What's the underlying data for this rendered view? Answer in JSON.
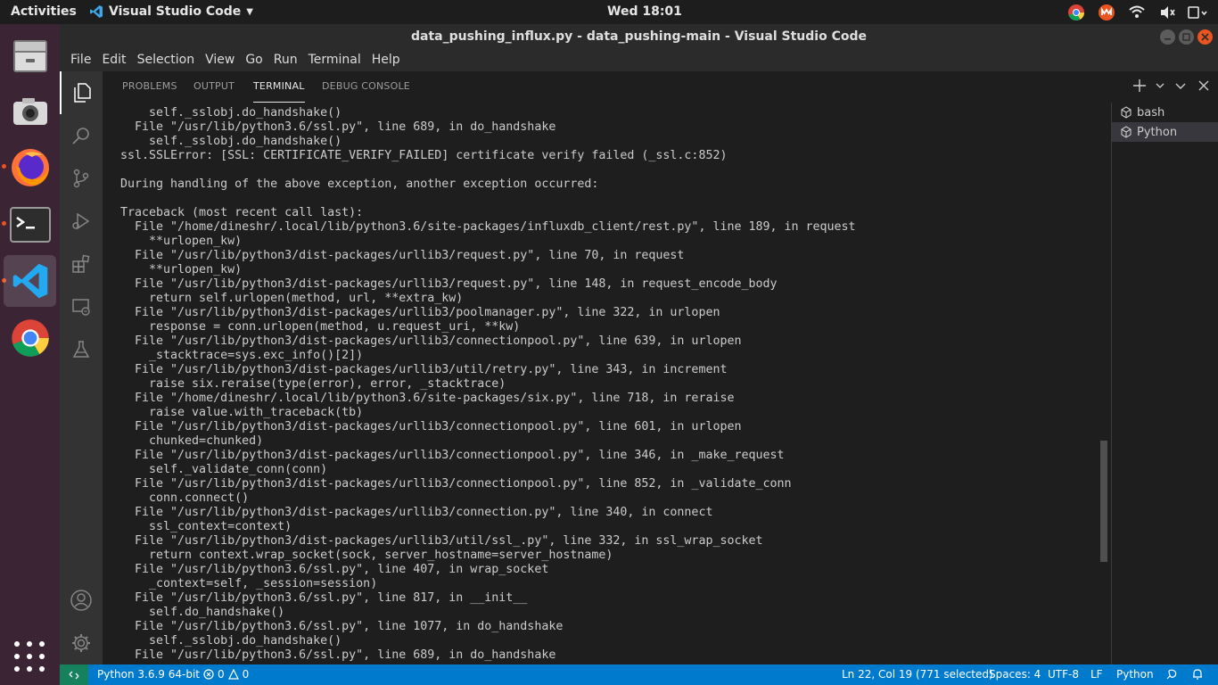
{
  "topbar": {
    "activities": "Activities",
    "app_name": "Visual Studio Code",
    "clock": "Wed 18:01"
  },
  "window": {
    "title": "data_pushing_influx.py - data_pushing-main - Visual Studio Code"
  },
  "menu": [
    "File",
    "Edit",
    "Selection",
    "View",
    "Go",
    "Run",
    "Terminal",
    "Help"
  ],
  "panel": {
    "tabs": [
      "PROBLEMS",
      "OUTPUT",
      "TERMINAL",
      "DEBUG CONSOLE"
    ],
    "active_tab": "TERMINAL"
  },
  "terminal_lines": [
    "    self._sslobj.do_handshake()",
    "  File \"/usr/lib/python3.6/ssl.py\", line 689, in do_handshake",
    "    self._sslobj.do_handshake()",
    "ssl.SSLError: [SSL: CERTIFICATE_VERIFY_FAILED] certificate verify failed (_ssl.c:852)",
    "",
    "During handling of the above exception, another exception occurred:",
    "",
    "Traceback (most recent call last):",
    "  File \"/home/dineshr/.local/lib/python3.6/site-packages/influxdb_client/rest.py\", line 189, in request",
    "    **urlopen_kw)",
    "  File \"/usr/lib/python3/dist-packages/urllib3/request.py\", line 70, in request",
    "    **urlopen_kw)",
    "  File \"/usr/lib/python3/dist-packages/urllib3/request.py\", line 148, in request_encode_body",
    "    return self.urlopen(method, url, **extra_kw)",
    "  File \"/usr/lib/python3/dist-packages/urllib3/poolmanager.py\", line 322, in urlopen",
    "    response = conn.urlopen(method, u.request_uri, **kw)",
    "  File \"/usr/lib/python3/dist-packages/urllib3/connectionpool.py\", line 639, in urlopen",
    "    _stacktrace=sys.exc_info()[2])",
    "  File \"/usr/lib/python3/dist-packages/urllib3/util/retry.py\", line 343, in increment",
    "    raise six.reraise(type(error), error, _stacktrace)",
    "  File \"/home/dineshr/.local/lib/python3.6/site-packages/six.py\", line 718, in reraise",
    "    raise value.with_traceback(tb)",
    "  File \"/usr/lib/python3/dist-packages/urllib3/connectionpool.py\", line 601, in urlopen",
    "    chunked=chunked)",
    "  File \"/usr/lib/python3/dist-packages/urllib3/connectionpool.py\", line 346, in _make_request",
    "    self._validate_conn(conn)",
    "  File \"/usr/lib/python3/dist-packages/urllib3/connectionpool.py\", line 852, in _validate_conn",
    "    conn.connect()",
    "  File \"/usr/lib/python3/dist-packages/urllib3/connection.py\", line 340, in connect",
    "    ssl_context=context)",
    "  File \"/usr/lib/python3/dist-packages/urllib3/util/ssl_.py\", line 332, in ssl_wrap_socket",
    "    return context.wrap_socket(sock, server_hostname=server_hostname)",
    "  File \"/usr/lib/python3.6/ssl.py\", line 407, in wrap_socket",
    "    _context=self, _session=session)",
    "  File \"/usr/lib/python3.6/ssl.py\", line 817, in __init__",
    "    self.do_handshake()",
    "  File \"/usr/lib/python3.6/ssl.py\", line 1077, in do_handshake",
    "    self._sslobj.do_handshake()",
    "  File \"/usr/lib/python3.6/ssl.py\", line 689, in do_handshake"
  ],
  "terminal_list": [
    {
      "label": "bash",
      "selected": false
    },
    {
      "label": "Python",
      "selected": true
    }
  ],
  "statusbar": {
    "interpreter": "Python 3.6.9 64-bit",
    "errors": "0",
    "warnings": "0",
    "position": "Ln 22, Col 19 (771 selected)",
    "spaces": "Spaces: 4",
    "encoding": "UTF-8",
    "eol": "LF",
    "language": "Python"
  },
  "colors": {
    "status_bar": "#007acc",
    "remote_indicator": "#16825d",
    "dock": "#3b2535",
    "accent_orange": "#e95420"
  }
}
